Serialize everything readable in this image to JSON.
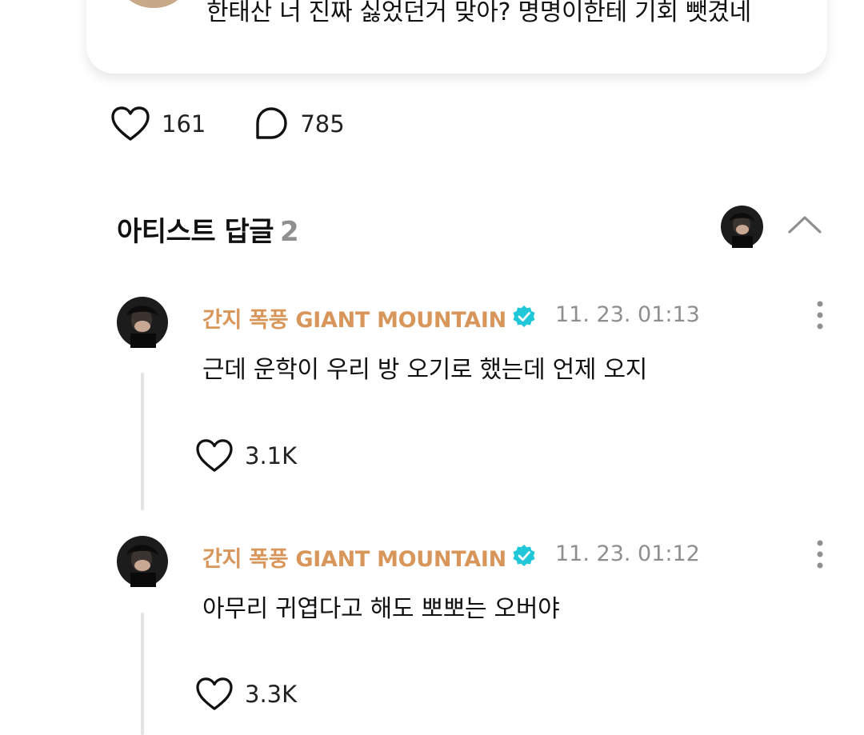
{
  "top_comment": {
    "text": "한태산 너 진짜 싫었던거 맞아? 명명이한테 기회 뺏겼네"
  },
  "stats": {
    "likes": "161",
    "comments": "785"
  },
  "section": {
    "title": "아티스트 답글",
    "count": "2"
  },
  "replies": [
    {
      "author": "간지 폭풍 GIANT MOUNTAIN",
      "time": "11. 23. 01:13",
      "text": "근데 운학이 우리 방 오기로 했는데 언제 오지",
      "likes": "3.1K"
    },
    {
      "author": "간지 폭풍 GIANT MOUNTAIN",
      "time": "11. 23. 01:12",
      "text": "아무리 귀엽다고 해도 뽀뽀는 오버야",
      "likes": "3.3K"
    }
  ],
  "colors": {
    "author": "#d9965a",
    "verified": "#1fc7d9",
    "muted": "#8e8e8e",
    "thread_line": "#e4e4e4"
  },
  "icons": {
    "like": "heart-outline-icon",
    "comment": "speech-bubble-icon",
    "collapse": "chevron-up-icon",
    "more": "more-vertical-icon",
    "verified": "verified-badge-icon"
  }
}
